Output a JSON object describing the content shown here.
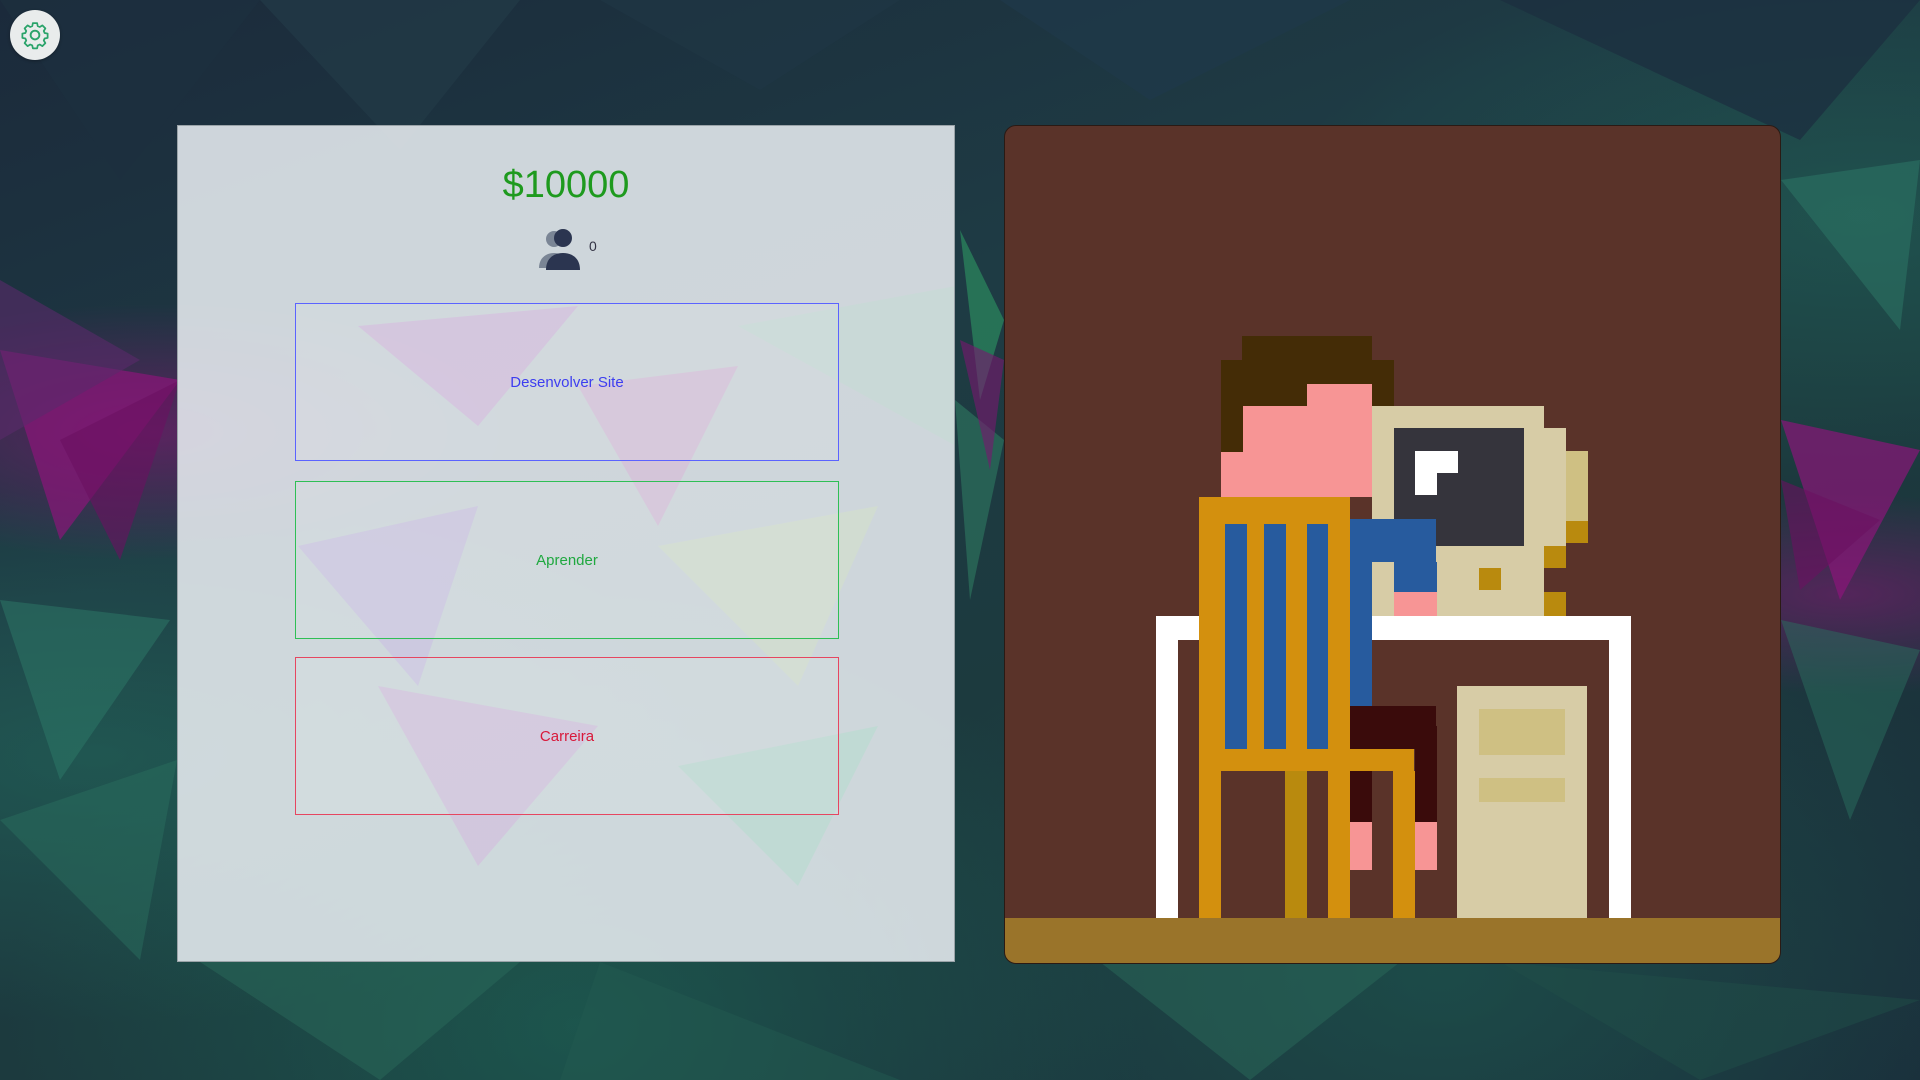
{
  "settings": {
    "icon": "gear-icon"
  },
  "stats": {
    "money": "$10000",
    "employees": "0",
    "employees_icon": "users-icon"
  },
  "actions": [
    {
      "label": "Desenvolver Site",
      "color": "#3d3df0"
    },
    {
      "label": "Aprender",
      "color": "#1fa83f"
    },
    {
      "label": "Carreira",
      "color": "#d8183a"
    }
  ],
  "scene": {
    "description_icon": "developer-at-computer-illustration"
  }
}
